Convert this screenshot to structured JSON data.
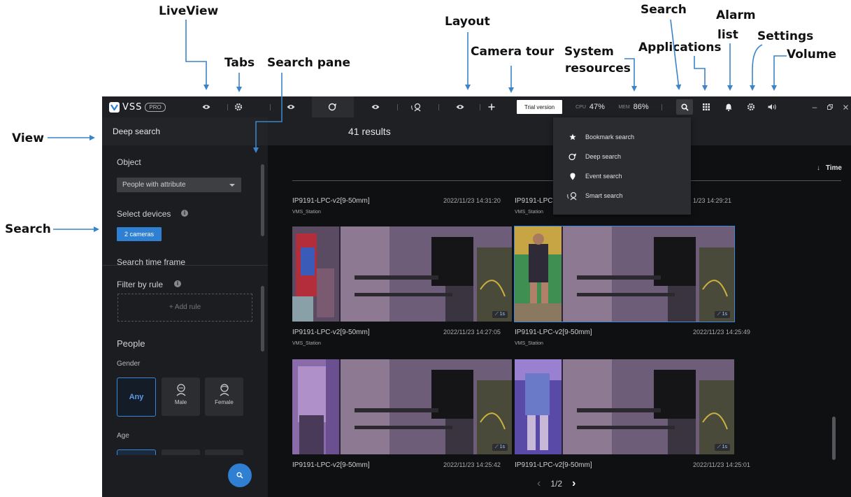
{
  "annotations": [
    {
      "text": "LiveView"
    },
    {
      "text": "Tabs"
    },
    {
      "text": "Search pane"
    },
    {
      "text": "Layout"
    },
    {
      "text": "Camera tour"
    },
    {
      "text": "System"
    },
    {
      "text": "resources"
    },
    {
      "text": "Search"
    },
    {
      "text": "Applications"
    },
    {
      "text": "Alarm"
    },
    {
      "text": "list"
    },
    {
      "text": "Settings"
    },
    {
      "text": "Volume"
    },
    {
      "text": "View"
    },
    {
      "text": "Search"
    }
  ],
  "topbar": {
    "logo_text": "VSS",
    "logo_badge": "PRO",
    "trial_label": "Trial version",
    "cpu_label": "CPU",
    "cpu_value": "47%",
    "mem_label": "MEM",
    "mem_value": "86%",
    "icons": [
      "eye-icon",
      "gear-icon",
      "eye-icon",
      "deep-search-icon",
      "eye-icon",
      "smart-search-icon",
      "eye-icon",
      "plus-icon",
      "search-icon",
      "grid-icon",
      "bell-icon",
      "gear-icon",
      "speaker-icon"
    ]
  },
  "pane": {
    "title": "Deep search",
    "object_label": "Object",
    "object_value": "People with attribute",
    "devices_label": "Select devices",
    "devices_button": "2 cameras",
    "timeframe_label": "Search time frame",
    "filter_label": "Filter by rule",
    "add_rule": "+   Add rule",
    "people_label": "People",
    "gender_label": "Gender",
    "gender_any": "Any",
    "gender_male": "Male",
    "gender_female": "Female",
    "age_label": "Age"
  },
  "main": {
    "results": "41 results",
    "sort_label": "Time",
    "cards": [
      {
        "title": "IP9191-LPC-v2[9-50mm]",
        "time": "2022/11/23 14:31:20",
        "sub": "VMS_Station"
      },
      {
        "title": "IP9191-LPC",
        "time": "1/23 14:29:21",
        "sub": "VMS_Station"
      },
      {
        "title": "IP9191-LPC-v2[9-50mm]",
        "time": "2022/11/23 14:27:05",
        "sub": "VMS_Station",
        "badge": "1s"
      },
      {
        "title": "IP9191-LPC-v2[9-50mm]",
        "time": "2022/11/23 14:25:49",
        "sub": "VMS_Station",
        "badge": "1s"
      },
      {
        "title": "IP9191-LPC-v2[9-50mm]",
        "time": "2022/11/23 14:25:42",
        "badge": "1s"
      },
      {
        "title": "IP9191-LPC-v2[9-50mm]",
        "time": "2022/11/23 14:25:01",
        "badge": "1s"
      }
    ],
    "pager": "1/2"
  },
  "menu": {
    "items": [
      {
        "label": "Bookmark search",
        "icon": "star-icon"
      },
      {
        "label": "Deep search",
        "icon": "deep-search-icon"
      },
      {
        "label": "Event search",
        "icon": "pin-icon"
      },
      {
        "label": "Smart search",
        "icon": "smart-search-icon"
      }
    ]
  },
  "colors": {
    "accent": "#2f7fd3",
    "annotation_arrow": "#3b84c9",
    "background": "#111214"
  }
}
